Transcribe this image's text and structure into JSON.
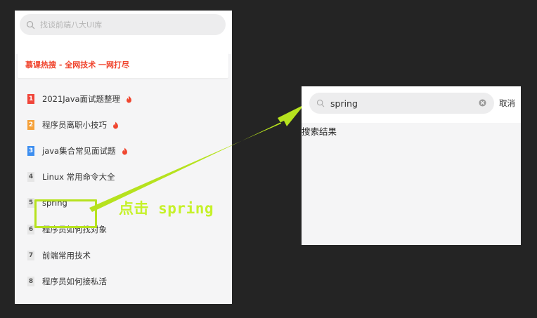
{
  "left_screen": {
    "search": {
      "placeholder": "找谈前端八大UI库"
    },
    "hot_header": {
      "title": "慕课热搜 - 全网技术 一网打尽",
      "color": "#f0452e"
    },
    "hot_list": [
      {
        "rank": "1",
        "label": "2021Java面试题整理",
        "hot": true,
        "rank_color": "#f0453a"
      },
      {
        "rank": "2",
        "label": "程序员离职小技巧",
        "hot": true,
        "rank_color": "#f5a13a"
      },
      {
        "rank": "3",
        "label": "java集合常见面试题",
        "hot": true,
        "rank_color": "#3d8ef0"
      },
      {
        "rank": "4",
        "label": "Linux 常用命令大全",
        "hot": false
      },
      {
        "rank": "5",
        "label": "spring",
        "hot": false
      },
      {
        "rank": "6",
        "label": "程序员如何找对象",
        "hot": false
      },
      {
        "rank": "7",
        "label": "前端常用技术",
        "hot": false
      },
      {
        "rank": "8",
        "label": "程序员如何接私活",
        "hot": false
      }
    ],
    "highlighted_rank": "5"
  },
  "annotation": {
    "callout_text": "点击 spring",
    "accent_color": "#b6e21e"
  },
  "right_screen": {
    "search": {
      "value": "spring"
    },
    "cancel_label": "取消",
    "result_title": "搜索结果"
  },
  "icons": {
    "search": "search-icon",
    "hot": "fire-icon",
    "clear": "clear-icon"
  }
}
